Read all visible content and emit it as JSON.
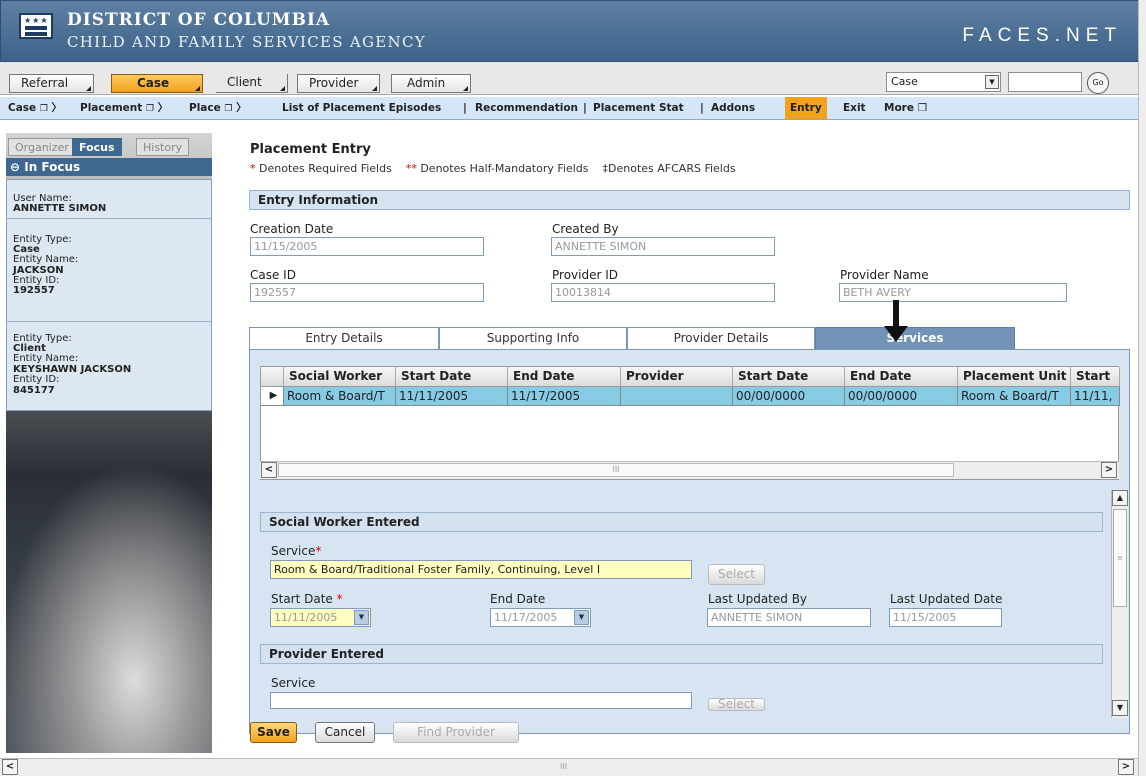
{
  "header": {
    "line1": "DISTRICT OF COLUMBIA",
    "line2": "CHILD AND FAMILY SERVICES AGENCY",
    "app": "FACES.NET",
    "flag_stars": "★★★"
  },
  "menu": {
    "tabs": [
      {
        "label": "Referral"
      },
      {
        "label": "Case",
        "active": true
      },
      {
        "label": "Client"
      },
      {
        "label": "Provider"
      },
      {
        "label": "Admin"
      }
    ],
    "search_type": "Case",
    "search_value": "",
    "go_label": "Go"
  },
  "crumbs": {
    "items": [
      "Case",
      "Placement",
      "Place"
    ],
    "nav": [
      "List of Placement Episodes",
      "Recommendation",
      "Placement Stat",
      "Addons",
      "Entry",
      "Exit",
      "More"
    ],
    "active_nav": "Entry",
    "separator": "|",
    "copy_glyph": "❐"
  },
  "sidebar": {
    "tabs": [
      "Organizer",
      "Focus",
      "History"
    ],
    "active_tab": "Focus",
    "in_focus_label": "In Focus",
    "user_name_label": "User Name:",
    "user_name": "ANNETTE SIMON",
    "entities": [
      {
        "type_label": "Entity Type:",
        "type": "Case",
        "name_label": "Entity Name:",
        "name": "JACKSON",
        "id_label": "Entity ID:",
        "id": "192557"
      },
      {
        "type_label": "Entity Type:",
        "type": "Client",
        "name_label": "Entity Name:",
        "name": "KEYSHAWN JACKSON",
        "id_label": "Entity ID:",
        "id": "845177"
      }
    ]
  },
  "page": {
    "title": "Placement Entry",
    "req_star": "*",
    "req_text": "Denotes Required Fields",
    "half_star": "**",
    "half_text": "Denotes Half-Mandatory Fields",
    "afcars_text": "‡Denotes AFCARS Fields"
  },
  "entry_info": {
    "title": "Entry Information",
    "creation_date_label": "Creation Date",
    "creation_date": "11/15/2005",
    "created_by_label": "Created By",
    "created_by": "ANNETTE SIMON",
    "case_id_label": "Case ID",
    "case_id": "192557",
    "provider_id_label": "Provider ID",
    "provider_id": "10013814",
    "provider_name_label": "Provider Name",
    "provider_name": "BETH AVERY"
  },
  "tabs": {
    "items": [
      "Entry Details",
      "Supporting Info",
      "Provider Details",
      "Services"
    ],
    "active": "Services"
  },
  "grid": {
    "columns": [
      "Social Worker",
      "Start Date",
      "End Date",
      "Provider",
      "Start Date",
      "End Date",
      "Placement Unit",
      "Start"
    ],
    "rows": [
      [
        "Room & Board/T",
        "11/11/2005",
        "11/17/2005",
        "",
        "00/00/0000",
        "00/00/0000",
        "Room & Board/T",
        "11/11,"
      ]
    ],
    "row_marker": "▶",
    "scroll_left": "<",
    "scroll_right": ">",
    "thumb_grip": "III"
  },
  "sw_entered": {
    "title": "Social Worker Entered",
    "service_label": "Service",
    "service_value": "Room & Board/Traditional Foster Family, Continuing, Level I",
    "select_label": "Select",
    "start_date_label": "Start Date",
    "start_date": "11/11/2005",
    "end_date_label": "End Date",
    "end_date": "11/17/2005",
    "last_updated_by_label": "Last Updated By",
    "last_updated_by": "ANNETTE SIMON",
    "last_updated_date_label": "Last Updated Date",
    "last_updated_date": "11/15/2005"
  },
  "provider_entered": {
    "title": "Provider Entered",
    "service_label": "Service",
    "service_value": "",
    "select_label": "Select"
  },
  "buttons": {
    "save": "Save",
    "cancel": "Cancel",
    "find_provider": "Find Provider"
  },
  "scroll": {
    "up": "▲",
    "down": "▼",
    "left": "<",
    "right": ">",
    "grip": "III",
    "vgrip": "≡"
  },
  "colors": {
    "accent": "#f2a21f",
    "header_blue": "#3e6890",
    "panel": "#d7e5f2",
    "selected_row": "#87cbe4"
  }
}
